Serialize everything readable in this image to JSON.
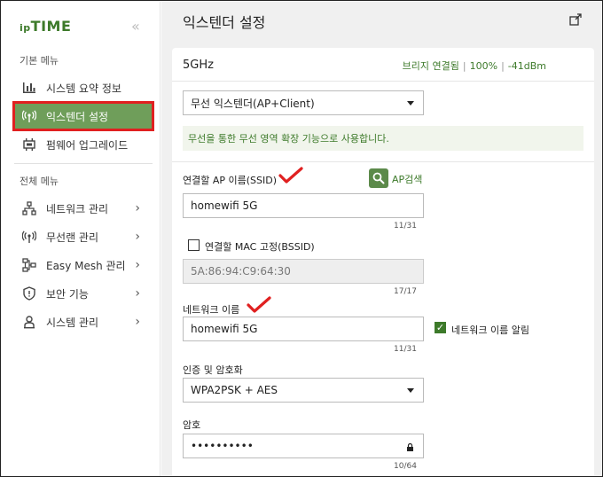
{
  "sidebar": {
    "logo_small": "ip",
    "logo_main": "TIME",
    "collapse_glyph": "«",
    "basic_menu_label": "기본 메뉴",
    "full_menu_label": "전체 메뉴",
    "basic_items": [
      {
        "label": "시스템 요약 정보",
        "icon": "bar-chart-icon"
      },
      {
        "label": "익스텐더 설정",
        "icon": "wireless-signal-icon",
        "active": true
      },
      {
        "label": "펌웨어 업그레이드",
        "icon": "firmware-chip-icon"
      }
    ],
    "full_items": [
      {
        "label": "네트워크 관리",
        "icon": "network-icon"
      },
      {
        "label": "무선랜 관리",
        "icon": "wireless-signal-icon"
      },
      {
        "label": "Easy Mesh 관리",
        "icon": "mesh-icon"
      },
      {
        "label": "보안 기능",
        "icon": "shield-icon"
      },
      {
        "label": "시스템 관리",
        "icon": "system-icon"
      }
    ],
    "chevron_glyph": "›"
  },
  "main": {
    "title": "익스텐더 설정",
    "export_icon": "export-icon"
  },
  "card": {
    "band": "5GHz",
    "status_mode": "브리지 연결됨",
    "status_quality": "100%",
    "status_signal": "-41dBm",
    "status_sep": "|",
    "mode_select": "무선 익스텐더(AP+Client)",
    "notice": "무선을 통한 무선 영역 확장 기능으로 사용합니다.",
    "ssid_label": "연결할 AP 이름(SSID)",
    "ap_search_label": "AP검색",
    "ssid_value": "homewifi 5G",
    "ssid_counter": "11/31",
    "mac_fix_label": "연결할 MAC 고정(BSSID)",
    "mac_value": "5A:86:94:C9:64:30",
    "mac_counter": "17/17",
    "network_name_label": "네트워크 이름",
    "network_name_value": "homewifi 5G",
    "network_name_counter": "11/31",
    "broadcast_label": "네트워크 이름 알림",
    "auth_label": "인증 및 암호화",
    "auth_value": "WPA2PSK + AES",
    "password_label": "암호",
    "password_value": "••••••••••",
    "password_counter": "10/64",
    "lock_glyph": "🔒"
  },
  "colors": {
    "accent_green": "#3d7a2a",
    "active_bg": "#6f9e5a",
    "highlight_red": "#e02020",
    "annotation_red": "#e02020"
  }
}
